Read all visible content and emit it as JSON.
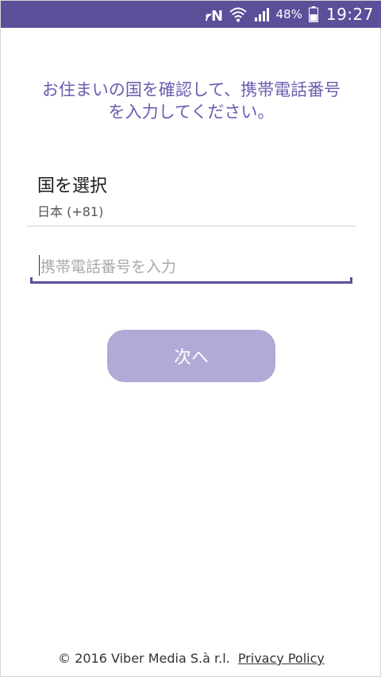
{
  "status_bar": {
    "icons": [
      "nfc-icon",
      "wifi-icon",
      "cellular-signal-icon",
      "battery-icon"
    ],
    "battery_percent": "48%",
    "time": "19:27"
  },
  "instruction": {
    "line1": "お住まいの国を確認して、携帯電話番号",
    "line2": "を入力してください。"
  },
  "country": {
    "title": "国を選択",
    "value": "日本 (+81)"
  },
  "phone_input": {
    "placeholder": "携帯電話番号を入力"
  },
  "next_button": {
    "label": "次へ"
  },
  "footer": {
    "copyright": "© 2016 Viber Media S.à r.l.",
    "privacy_link": "Privacy Policy"
  },
  "colors": {
    "brand": "#5b4f9a",
    "instruction_text": "#6a5db0",
    "button_disabled": "#b0aad6"
  }
}
